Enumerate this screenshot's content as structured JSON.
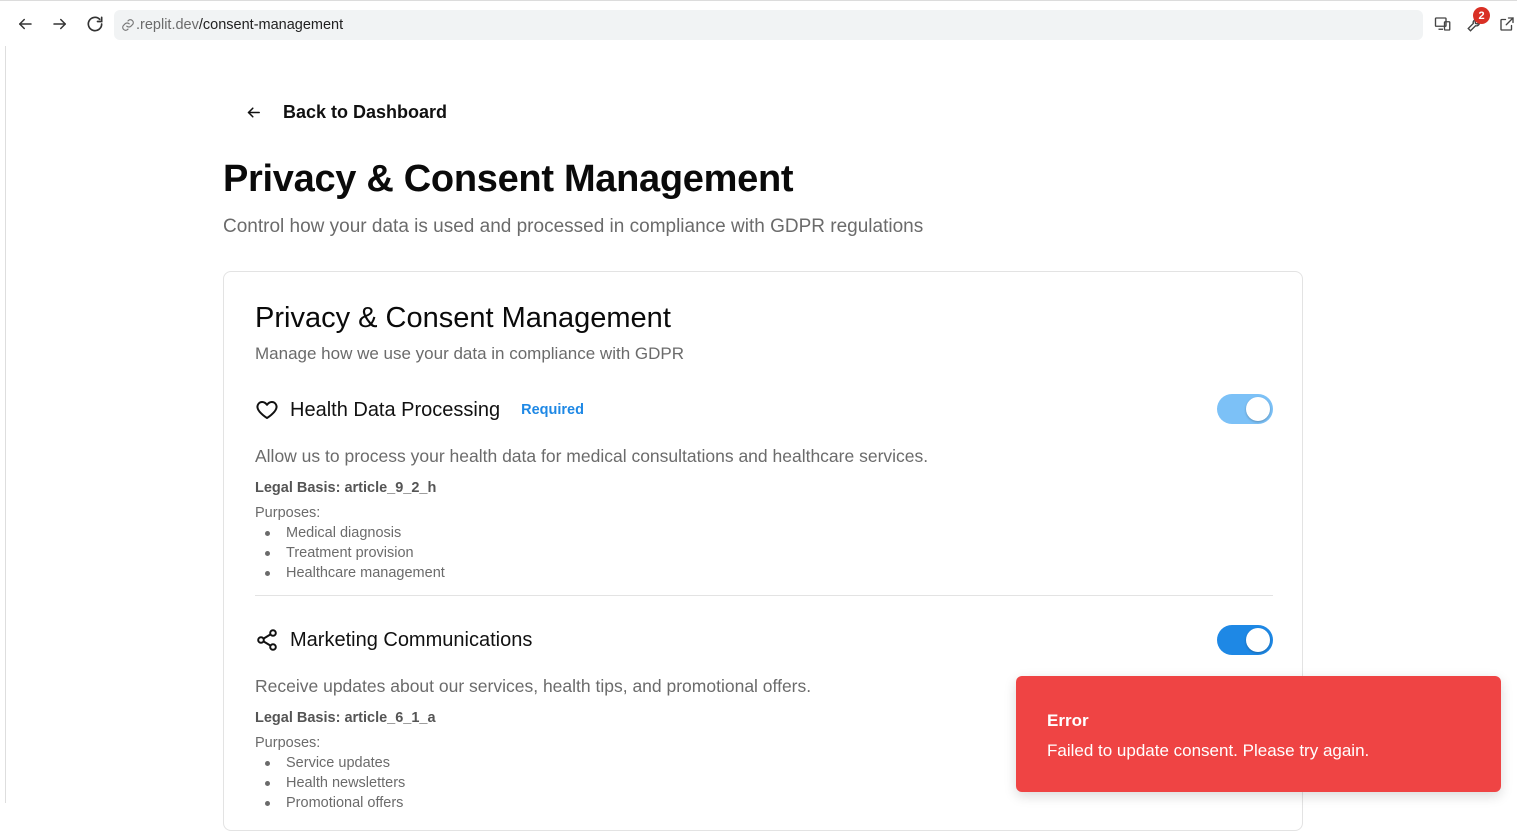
{
  "browser": {
    "url_prefix": ".replit.dev",
    "url_path": "/consent-management",
    "notification_count": "2"
  },
  "page": {
    "back_label": "Back to Dashboard",
    "title": "Privacy & Consent Management",
    "subtitle": "Control how your data is used and processed in compliance with GDPR regulations"
  },
  "card": {
    "title": "Privacy & Consent Management",
    "subtitle": "Manage how we use your data in compliance with GDPR"
  },
  "consents": [
    {
      "icon": "heart-icon",
      "title": "Health Data Processing",
      "badge": "Required",
      "enabled": true,
      "locked": true,
      "description": "Allow us to process your health data for medical consultations and healthcare services.",
      "legal_basis": "Legal Basis: article_9_2_h",
      "purposes_label": "Purposes:",
      "purposes": [
        "Medical diagnosis",
        "Treatment provision",
        "Healthcare management"
      ]
    },
    {
      "icon": "share-icon",
      "title": "Marketing Communications",
      "enabled": true,
      "locked": false,
      "description": "Receive updates about our services, health tips, and promotional offers.",
      "legal_basis": "Legal Basis: article_6_1_a",
      "purposes_label": "Purposes:",
      "purposes": [
        "Service updates",
        "Health newsletters",
        "Promotional offers"
      ]
    }
  ],
  "toast": {
    "title": "Error",
    "message": "Failed to update consent. Please try again.",
    "color": "#ef4444"
  },
  "colors": {
    "accent": "#1e88e5",
    "accent_disabled": "#7cc1f7",
    "muted_text": "#6b6b6b"
  }
}
